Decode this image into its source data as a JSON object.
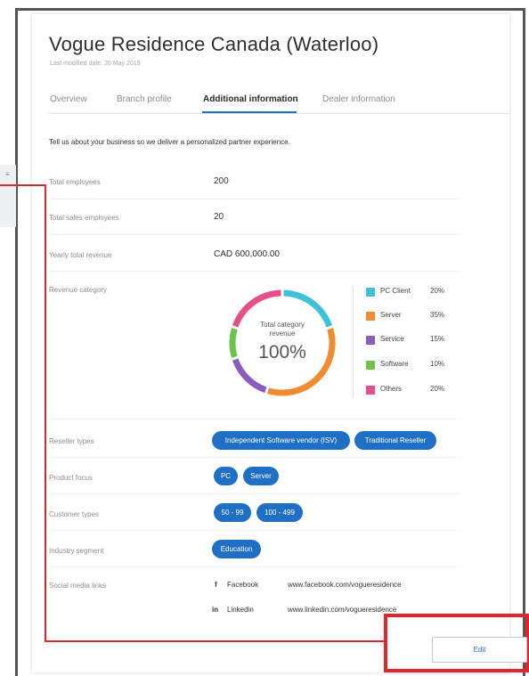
{
  "header": {
    "title": "Vogue Residence Canada (Waterloo)",
    "last_modified": "Last modified date: 20 May 2019"
  },
  "tabs": [
    {
      "label": "Overview",
      "active": false
    },
    {
      "label": "Branch profile",
      "active": false
    },
    {
      "label": "Additional information",
      "active": true
    },
    {
      "label": "Dealer information",
      "active": false
    }
  ],
  "intro": "Tell us about your business so we deliver a personalized partner experience.",
  "fields": {
    "total_employees": {
      "label": "Total employees",
      "value": "200"
    },
    "total_sales_employees": {
      "label": "Total sales employees",
      "value": "20"
    },
    "yearly_total_revenue": {
      "label": "Yearly total revenue",
      "value": "CAD 600,000.00"
    },
    "revenue_category": {
      "label": "Revenue category"
    },
    "reseller_types": {
      "label": "Reseller types",
      "chips": [
        "Independent Software vendor (ISV)",
        "Traditional Reseller"
      ]
    },
    "product_focus": {
      "label": "Product focus",
      "chips": [
        "PC",
        "Server"
      ]
    },
    "customer_types": {
      "label": "Customer types",
      "chips": [
        "50 - 99",
        "100 - 499"
      ]
    },
    "industry_segment": {
      "label": "Industry segment",
      "chips": [
        "Education"
      ]
    },
    "social_media_links": {
      "label": "Social media links",
      "links": [
        {
          "icon": "f",
          "name": "Facebook",
          "url": "www.facebook.com/vogueresidence"
        },
        {
          "icon": "in",
          "name": "Linkedin",
          "url": "www.linkedin.com/vogueresidence"
        }
      ]
    }
  },
  "chart_data": {
    "type": "pie",
    "center_line1": "Total category",
    "center_line2": "revenue",
    "center_total": "100%",
    "categories": [
      "PC Client",
      "Server",
      "Service",
      "Software",
      "Others"
    ],
    "values": [
      20,
      35,
      15,
      10,
      20
    ],
    "value_labels": [
      "20%",
      "35%",
      "15%",
      "10%",
      "20%"
    ],
    "colors": [
      "#3fc1dc",
      "#f28b30",
      "#8a5cc0",
      "#6cc24a",
      "#e64f8a"
    ]
  },
  "actions": {
    "edit_label": "Edit"
  },
  "left_stub_mark": "≡"
}
